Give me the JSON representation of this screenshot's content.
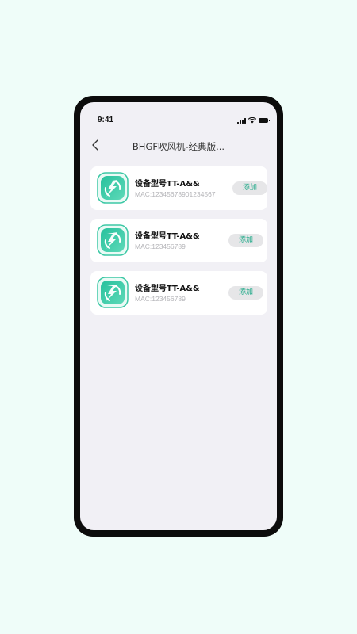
{
  "status_bar": {
    "time": "9:41",
    "icons": [
      "signal-icon",
      "wifi-icon",
      "battery-icon"
    ]
  },
  "nav": {
    "back_icon": "chevron-left-icon",
    "title": "BHGF吹风机-经典版..."
  },
  "devices": [
    {
      "name": "设备型号TT-A&&",
      "mac": "MAC:12345678901234567",
      "add_label": "添加"
    },
    {
      "name": "设备型号TT-A&&",
      "mac": "MAC:123456789",
      "add_label": "添加"
    },
    {
      "name": "设备型号TT-A&&",
      "mac": "MAC:123456789",
      "add_label": "添加"
    }
  ],
  "colors": {
    "accent": "#1fa988",
    "icon_gradient_start": "#27c19d",
    "icon_gradient_end": "#5ed9b8",
    "background": "#effdf9"
  }
}
